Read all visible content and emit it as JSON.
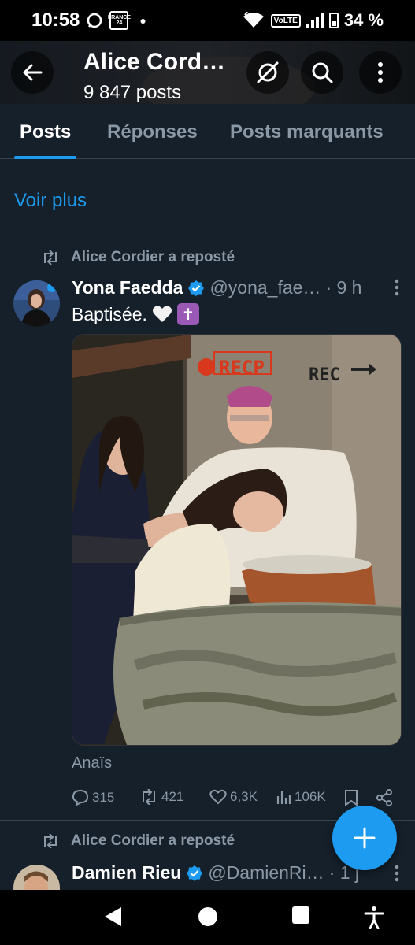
{
  "status_bar": {
    "time": "10:58",
    "network_badge": "FRANCE 24",
    "volte": "VoLTE",
    "battery": "34 %"
  },
  "header": {
    "title": "Alice Cord…",
    "subtitle": "9 847 posts"
  },
  "tabs": [
    {
      "label": "Posts",
      "active": true
    },
    {
      "label": "Réponses",
      "active": false
    },
    {
      "label": "Posts marquants",
      "active": false
    }
  ],
  "voir_plus": "Voir plus",
  "posts": [
    {
      "repost_label": "Alice Cordier a reposté",
      "author_name": "Yona Faedda",
      "handle": "@yona_fae…",
      "time": "· 9 h",
      "text": "Baptisée.",
      "media_caption": "Anaïs",
      "overlay_rec1": "RECP",
      "overlay_rec2": "REC",
      "stats": {
        "replies": "315",
        "reposts": "421",
        "likes": "6,3K",
        "views": "106K"
      }
    },
    {
      "repost_label": "Alice Cordier a reposté",
      "author_name": "Damien Rieu",
      "handle": "@DamienRi…",
      "time": "· 1 j"
    }
  ],
  "colors": {
    "accent": "#1d9bf0",
    "background": "#15202b",
    "muted": "#8b98a5"
  }
}
